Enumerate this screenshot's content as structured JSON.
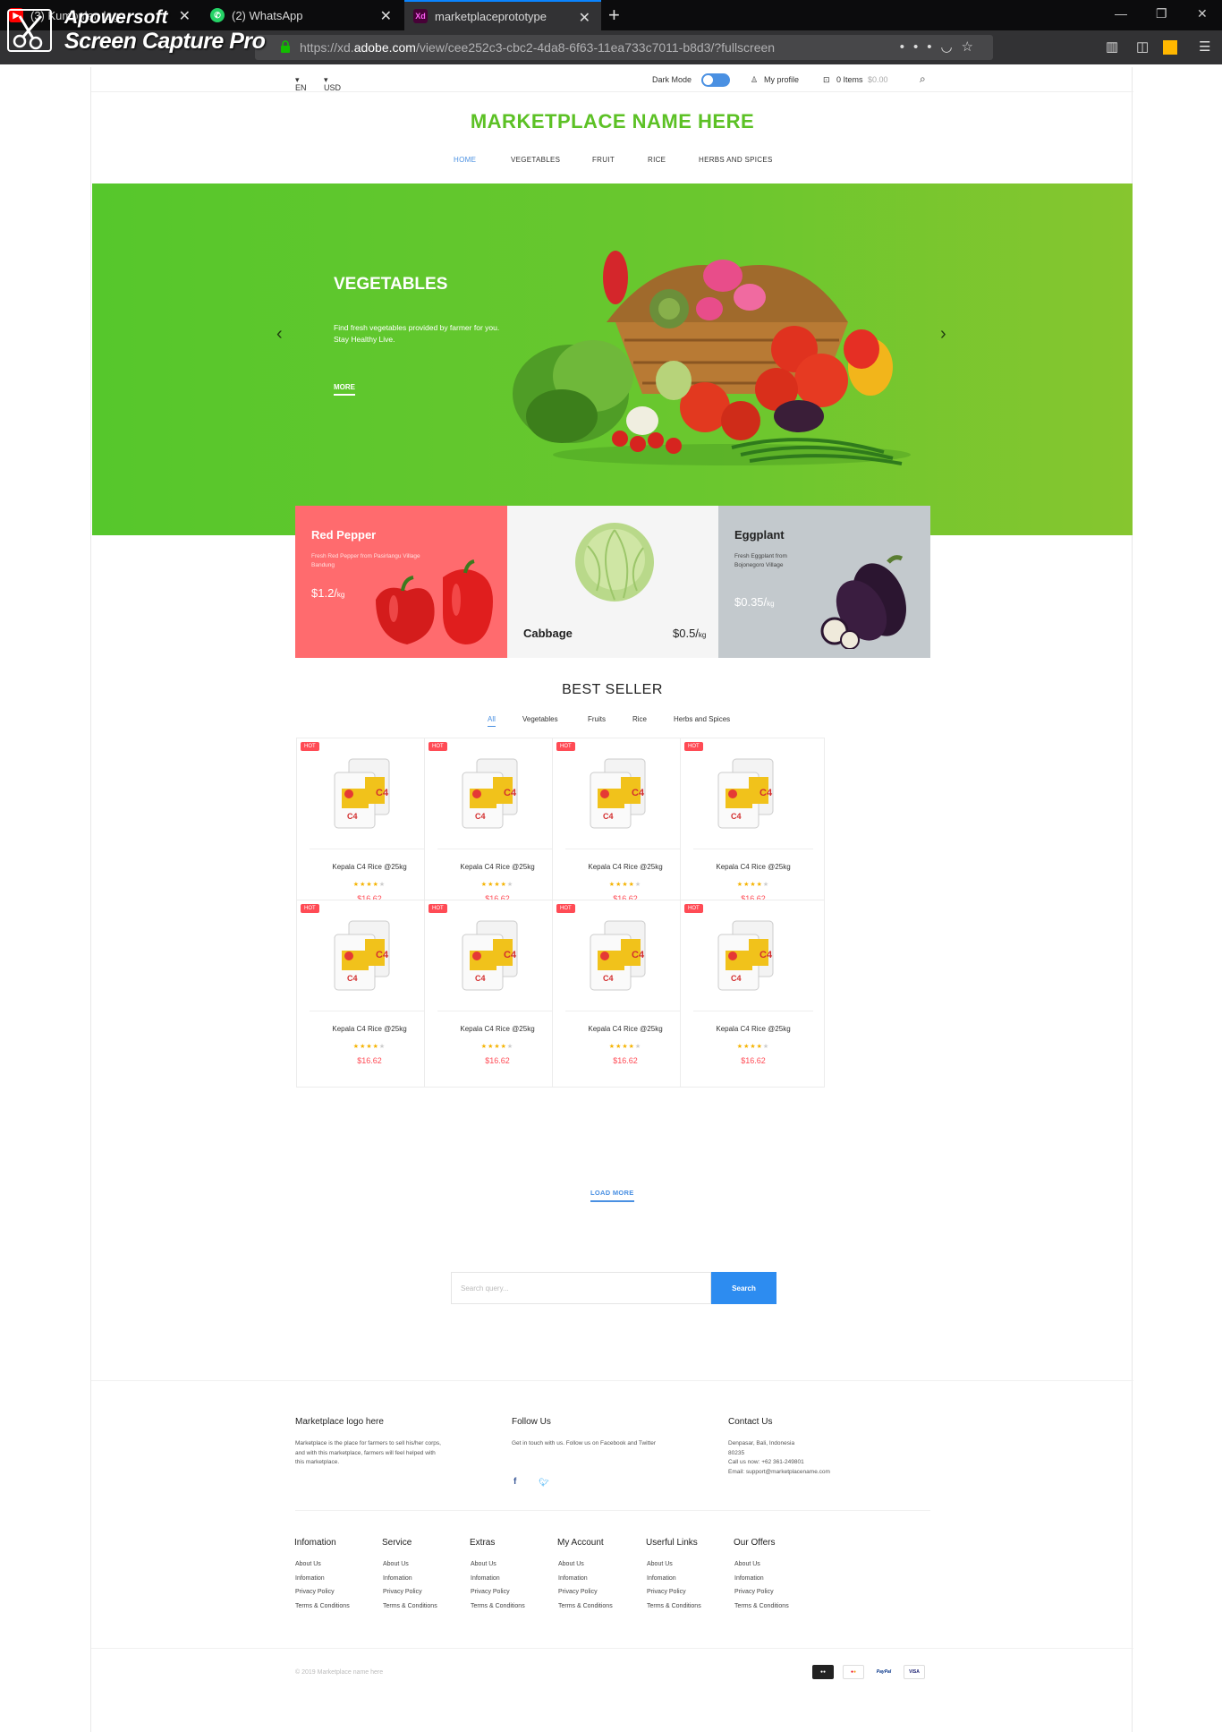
{
  "browser": {
    "tabs": [
      {
        "label": "(3) Kumpulan lagu",
        "icon": "youtube-icon"
      },
      {
        "label": "(2) WhatsApp",
        "icon": "whatsapp-icon"
      },
      {
        "label": "marketplaceprototype",
        "icon": "adobe-xd-icon"
      }
    ],
    "url_prefix": "https://xd.",
    "url_domain": "adobe.com",
    "url_path": "/view/cee252c3-cbc2-4da8-6f63-11ea733c7011-b8d3/?fullscreen",
    "watermark_line1": "Apowersoft",
    "watermark_line2": "Screen Capture Pro"
  },
  "topbar": {
    "language": "EN",
    "currency": "USD",
    "dark_mode_label": "Dark Mode",
    "dark_mode_on": true,
    "profile_label": "My profile",
    "cart_items": "0 Items",
    "cart_total": "$0.00"
  },
  "brand": "MARKETPLACE NAME HERE",
  "nav": [
    "HOME",
    "VEGETABLES",
    "FRUIT",
    "RICE",
    "HERBS AND SPICES"
  ],
  "hero": {
    "title": "VEGETABLES",
    "desc_line1": "Find fresh vegetables provided by farmer for you.",
    "desc_line2": "Stay Healthy Live.",
    "more": "MORE",
    "colors": {
      "start": "#56c72c",
      "end": "#86c62f"
    }
  },
  "promos": [
    {
      "title": "Red Pepper",
      "desc": "Fresh Red Pepper from Pasirlangu Village Bandung",
      "price": "$1.2/",
      "unit": "kg",
      "color": "#ff6b6e"
    },
    {
      "title": "Cabbage",
      "desc": "",
      "price": "$0.5/",
      "unit": "kg",
      "color": "#f5f5f5"
    },
    {
      "title": "Eggplant",
      "desc": "Fresh Eggplant from Bojonegoro Village",
      "price": "$0.35/",
      "unit": "kg",
      "color": "#c3c9cd"
    }
  ],
  "best_seller": {
    "title": "BEST SELLER",
    "tabs": [
      "All",
      "Vegetables",
      "Fruits",
      "Rice",
      "Herbs and Spices"
    ],
    "badge": "HOT",
    "product_name": "Kepala C4 Rice @25kg",
    "product_price": "$16.62",
    "rating": 4,
    "rating_max": 5,
    "product_count": 8,
    "load_more": "LOAD MORE"
  },
  "search": {
    "placeholder": "Search query...",
    "button": "Search"
  },
  "footer": {
    "about_title": "Marketplace logo here",
    "about_text": "Marketplace is the place for farmers to sell his/her corps, and with this marketplace, farmers will feel helped with this marketplace.",
    "follow_title": "Follow Us",
    "follow_text": "Get in touch with us. Follow us on Facebook and Twitter",
    "contact_title": "Contact Us",
    "contact_lines": [
      "Denpasar, Bali, Indonesia",
      "80235",
      "Call us now: +62 361-249801",
      "Email: support@marketplacename.com"
    ],
    "columns": [
      {
        "title": "Infomation",
        "links": [
          "About Us",
          "Infomation",
          "Privacy Policy",
          "Terms & Conditions"
        ]
      },
      {
        "title": "Service",
        "links": [
          "About Us",
          "Infomation",
          "Privacy Policy",
          "Terms & Conditions"
        ]
      },
      {
        "title": "Extras",
        "links": [
          "About Us",
          "Infomation",
          "Privacy Policy",
          "Terms & Conditions"
        ]
      },
      {
        "title": "My Account",
        "links": [
          "About Us",
          "Infomation",
          "Privacy Policy",
          "Terms & Conditions"
        ]
      },
      {
        "title": "Userful Links",
        "links": [
          "About Us",
          "Infomation",
          "Privacy Policy",
          "Terms & Conditions"
        ]
      },
      {
        "title": "Our Offers",
        "links": [
          "About Us",
          "Infomation",
          "Privacy Policy",
          "Terms & Conditions"
        ]
      }
    ],
    "copyright": "© 2019 Marketplace name here",
    "payments": [
      "Mastercard",
      "PayPal",
      "VISA"
    ],
    "accent": "#5cc125",
    "link_blue": "#2d8cf0"
  }
}
